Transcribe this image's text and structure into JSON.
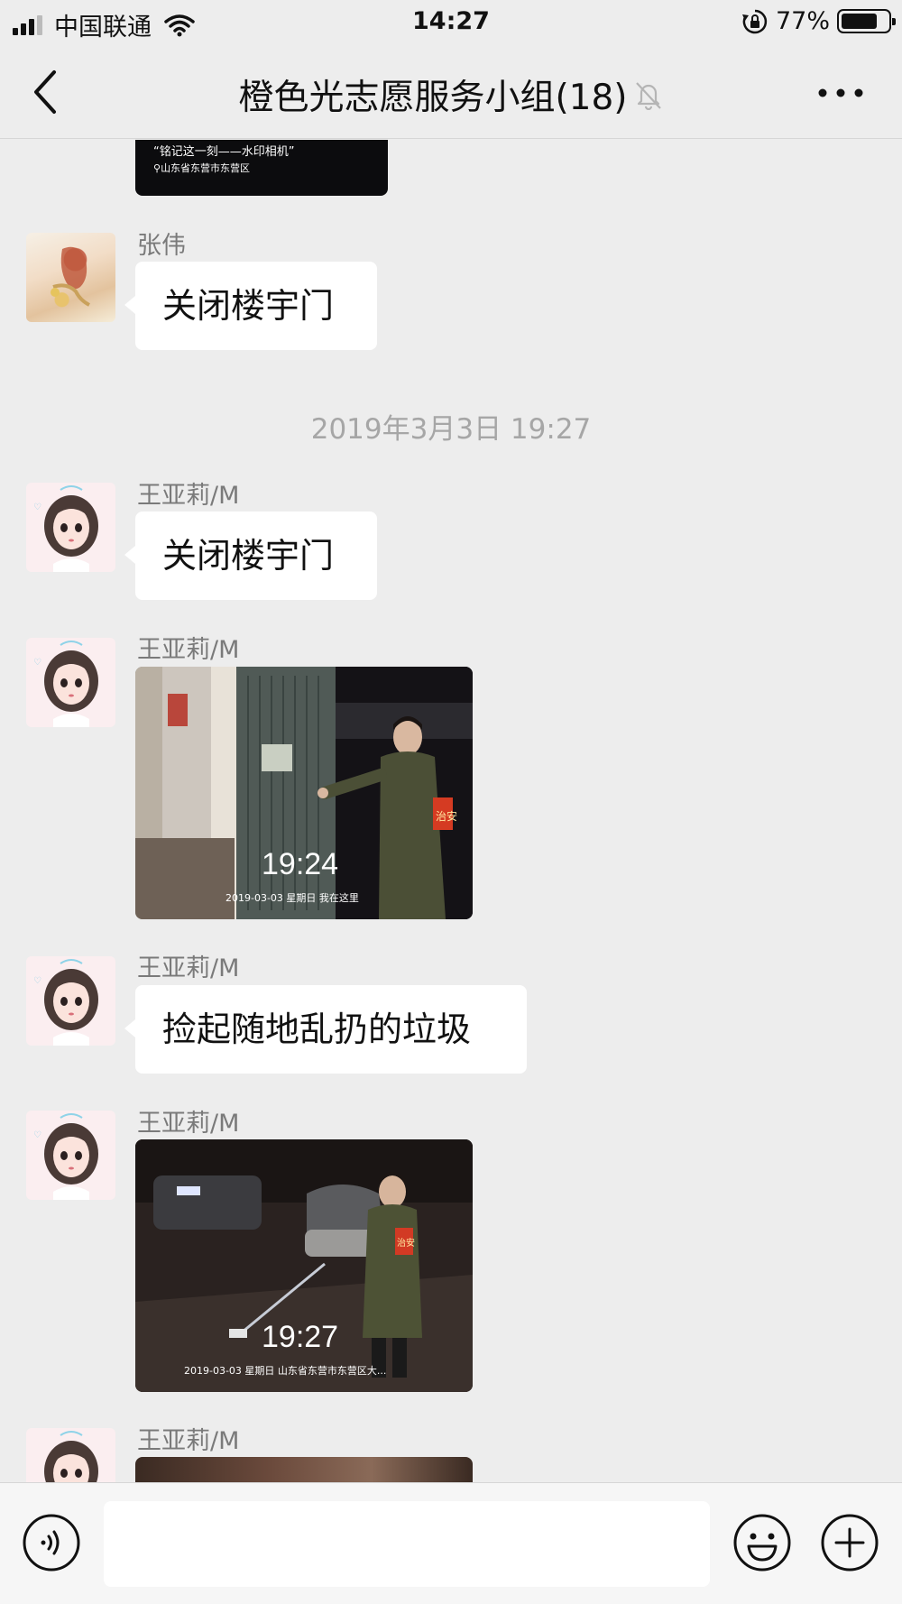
{
  "status_bar": {
    "carrier": "中国联通",
    "time": "14:27",
    "battery_percent": "77%",
    "battery_level": 0.77
  },
  "nav": {
    "title": "橙色光志愿服务小组(18)"
  },
  "chat": {
    "partial_photo_caption": "“铭记这一刻——水印相机”",
    "partial_photo_location": "山东省东营市东营区",
    "timestamp": "2019年3月3日 19:27",
    "messages": [
      {
        "sender": "张伟",
        "text": "关闭楼宇门"
      },
      {
        "sender": "王亚莉/M",
        "text": "关闭楼宇门"
      },
      {
        "sender": "王亚莉/M",
        "photo_time": "19:24",
        "photo_caption": "2019-03-03  星期日  我在这里"
      },
      {
        "sender": "王亚莉/M",
        "text": "捡起随地乱扔的垃圾"
      },
      {
        "sender": "王亚莉/M",
        "photo_time": "19:27",
        "photo_caption": "2019-03-03  星期日  山东省东营市东营区大..."
      },
      {
        "sender": "王亚莉/M"
      }
    ],
    "armband_text": "治安"
  },
  "input_bar": {
    "voice_icon": "voice-icon",
    "emoji_icon": "emoji-icon",
    "add_icon": "add-icon",
    "placeholder": ""
  },
  "colors": {
    "background": "#ededed",
    "bubble": "#ffffff",
    "meta_text": "#7a7a7a"
  }
}
